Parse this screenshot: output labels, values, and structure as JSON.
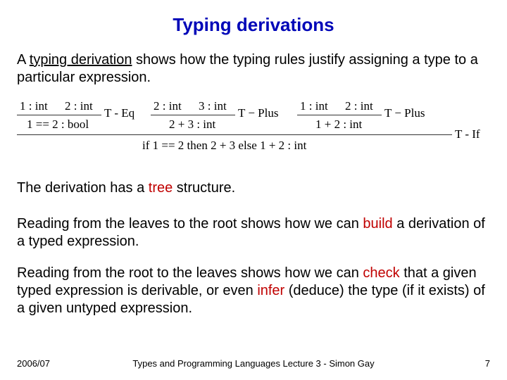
{
  "title": "Typing derivations",
  "para1": {
    "a": "A ",
    "keyword": "typing derivation",
    "b": " shows how the typing rules justify assigning a type to a particular expression."
  },
  "deriv": {
    "sub1": {
      "p1": "1 : int",
      "p2": "2 : int",
      "rule": "T - Eq",
      "conc": "1 == 2 : bool"
    },
    "sub2": {
      "p1": "2 : int",
      "p2": "3 : int",
      "rule": "T − Plus",
      "conc": "2 + 3 : int"
    },
    "sub3": {
      "p1": "1 : int",
      "p2": "2 : int",
      "rule": "T − Plus",
      "conc": "1 + 2 : int"
    },
    "mainConc": "if 1 == 2 then 2 + 3 else 1 + 2 : int",
    "mainRule": "T - If"
  },
  "para2": {
    "a": "The derivation has a ",
    "kw": "tree",
    "b": " structure."
  },
  "para3": {
    "a": "Reading from the leaves to the root shows how we can ",
    "kw": "build",
    "b": " a derivation of a typed expression."
  },
  "para4": {
    "a": "Reading from the root to the leaves shows how we can ",
    "kw1": "check",
    "b": " that a given typed expression is derivable, or even ",
    "kw2": "infer",
    "c": " (deduce) the type (if it exists) of a given untyped expression."
  },
  "footer": {
    "left": "2006/07",
    "center": "Types and Programming Languages Lecture 3 - Simon Gay",
    "right": "7"
  }
}
